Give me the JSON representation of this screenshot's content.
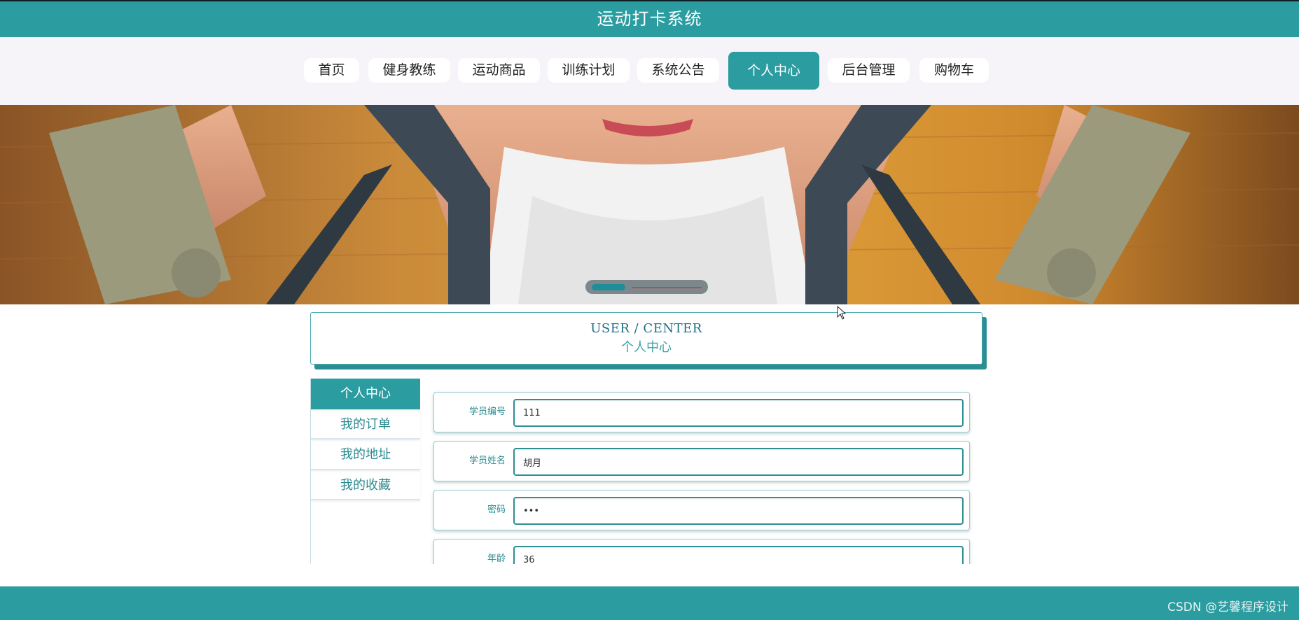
{
  "app": {
    "title": "运动打卡系统"
  },
  "nav": {
    "items": [
      {
        "label": "首页"
      },
      {
        "label": "健身教练"
      },
      {
        "label": "运动商品"
      },
      {
        "label": "训练计划"
      },
      {
        "label": "系统公告"
      },
      {
        "label": "个人中心",
        "active": true
      },
      {
        "label": "后台管理"
      },
      {
        "label": "购物车"
      }
    ]
  },
  "banner": {
    "slide_index": 1,
    "slide_count": 2
  },
  "section": {
    "title_en": "USER / CENTER",
    "title_cn": "个人中心"
  },
  "sidebar": {
    "items": [
      {
        "label": "个人中心",
        "active": true
      },
      {
        "label": "我的订单"
      },
      {
        "label": "我的地址"
      },
      {
        "label": "我的收藏"
      }
    ]
  },
  "form": {
    "fields": [
      {
        "label": "学员编号",
        "value": "111"
      },
      {
        "label": "学员姓名",
        "value": "胡月"
      },
      {
        "label": "密码",
        "value": "•••"
      },
      {
        "label": "年龄",
        "value": "36"
      }
    ]
  },
  "footer": {
    "watermark": "CSDN @艺馨程序设计"
  },
  "colors": {
    "primary": "#2b9ca0",
    "nav_bg": "#f6f4f8",
    "text_accent": "#2b8a90"
  }
}
